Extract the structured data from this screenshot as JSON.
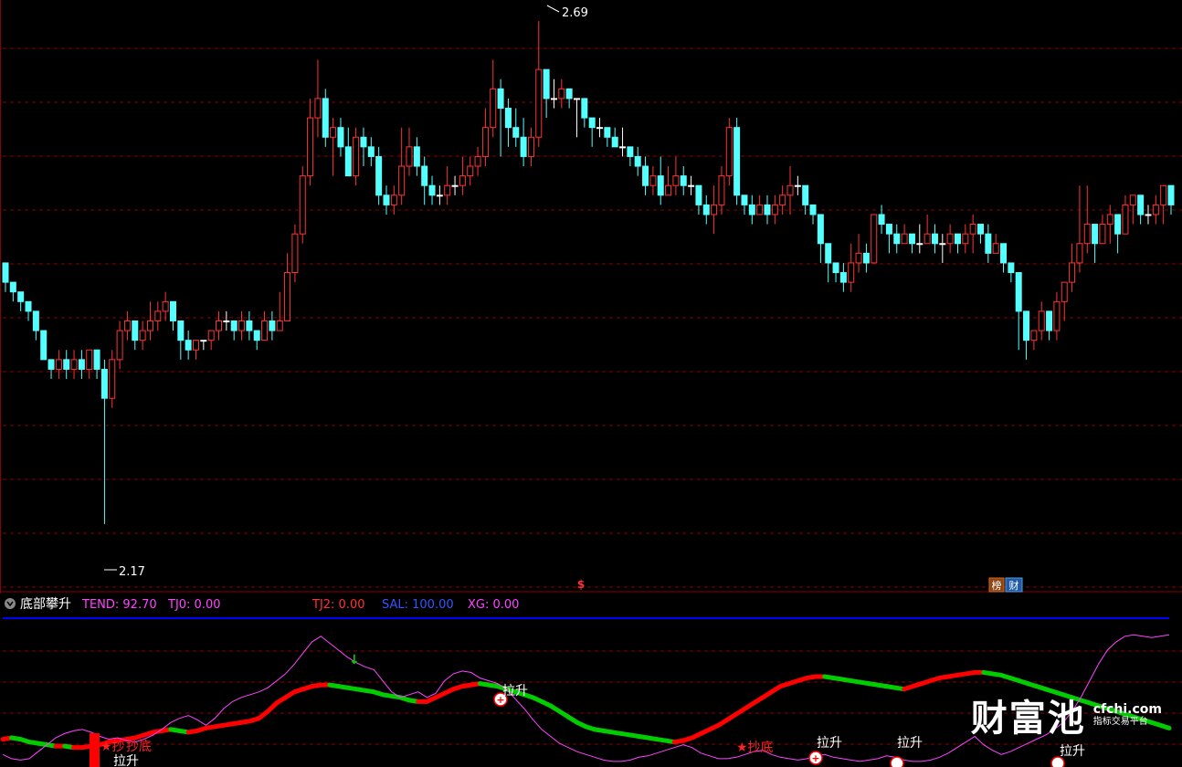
{
  "colors": {
    "up": "#ff3333",
    "down": "#54ffff",
    "flat": "#ffffff",
    "grid": "#8b0000",
    "separator": "#0000ff",
    "tend": "#ff44ff",
    "tj0": "#ff44ff",
    "tj2": "#ff3333",
    "sal": "#3355ff",
    "xg": "#ff44ff",
    "text": "#ffffff"
  },
  "price_panel": {
    "high_label": "2.69",
    "low_label": "2.17",
    "dollar_icon": "$",
    "badge1": "榜",
    "badge2": "财"
  },
  "indicator_panel": {
    "name": "底部攀升",
    "tend": "TEND: 92.70",
    "tj0": "TJ0: 0.00",
    "tj2": "TJ2: 0.00",
    "sal": "SAL: 100.00",
    "xg": "XG: 0.00"
  },
  "signals": {
    "rise": "拉升",
    "bottom": "抄底",
    "bottom_star": "★抄底",
    "bottom_double": "★抄",
    "arrow_down": "↓"
  },
  "watermark": {
    "main": "财富池",
    "en": "cfchi.com",
    "sub": "指标交易平台"
  },
  "chart_data": [
    {
      "type": "candlestick",
      "title": "",
      "y_visible_range": [
        2.1,
        2.71
      ],
      "max_label": 2.69,
      "min_label": 2.17,
      "grid": true,
      "candles": [
        [
          2.44,
          2.42,
          2.43,
          2.41
        ],
        [
          2.42,
          2.41,
          2.42,
          2.4
        ],
        [
          2.41,
          2.4,
          2.41,
          2.39
        ],
        [
          2.4,
          2.39,
          2.4,
          2.38
        ],
        [
          2.39,
          2.37,
          2.39,
          2.36
        ],
        [
          2.37,
          2.34,
          2.37,
          2.34
        ],
        [
          2.34,
          2.33,
          2.34,
          2.32
        ],
        [
          2.33,
          2.34,
          2.35,
          2.32
        ],
        [
          2.34,
          2.33,
          2.35,
          2.32
        ],
        [
          2.33,
          2.34,
          2.35,
          2.32
        ],
        [
          2.34,
          2.33,
          2.35,
          2.32
        ],
        [
          2.33,
          2.35,
          2.35,
          2.32
        ],
        [
          2.35,
          2.33,
          2.35,
          2.32
        ],
        [
          2.33,
          2.3,
          2.34,
          2.17
        ],
        [
          2.3,
          2.34,
          2.35,
          2.29
        ],
        [
          2.34,
          2.37,
          2.38,
          2.33
        ],
        [
          2.37,
          2.38,
          2.39,
          2.36
        ],
        [
          2.38,
          2.36,
          2.38,
          2.35
        ],
        [
          2.36,
          2.37,
          2.38,
          2.35
        ],
        [
          2.37,
          2.38,
          2.4,
          2.36
        ],
        [
          2.38,
          2.39,
          2.4,
          2.37
        ],
        [
          2.39,
          2.4,
          2.41,
          2.38
        ],
        [
          2.4,
          2.38,
          2.4,
          2.37
        ],
        [
          2.38,
          2.36,
          2.38,
          2.34
        ],
        [
          2.36,
          2.35,
          2.37,
          2.34
        ],
        [
          2.35,
          2.36,
          2.36,
          2.34
        ],
        [
          2.36,
          2.36,
          2.36,
          2.35
        ],
        [
          2.36,
          2.37,
          2.37,
          2.35
        ],
        [
          2.37,
          2.38,
          2.39,
          2.36
        ],
        [
          2.38,
          2.38,
          2.39,
          2.37
        ],
        [
          2.38,
          2.37,
          2.38,
          2.36
        ],
        [
          2.37,
          2.38,
          2.39,
          2.36
        ],
        [
          2.38,
          2.37,
          2.39,
          2.36
        ],
        [
          2.37,
          2.36,
          2.37,
          2.35
        ],
        [
          2.36,
          2.38,
          2.39,
          2.36
        ],
        [
          2.38,
          2.37,
          2.39,
          2.36
        ],
        [
          2.37,
          2.38,
          2.41,
          2.37
        ],
        [
          2.38,
          2.43,
          2.45,
          2.38
        ],
        [
          2.43,
          2.47,
          2.48,
          2.42
        ],
        [
          2.47,
          2.53,
          2.54,
          2.46
        ],
        [
          2.53,
          2.59,
          2.61,
          2.52
        ],
        [
          2.59,
          2.61,
          2.65,
          2.57
        ],
        [
          2.61,
          2.57,
          2.62,
          2.56
        ],
        [
          2.57,
          2.58,
          2.59,
          2.53
        ],
        [
          2.58,
          2.56,
          2.59,
          2.55
        ],
        [
          2.56,
          2.53,
          2.58,
          2.53
        ],
        [
          2.53,
          2.57,
          2.58,
          2.52
        ],
        [
          2.57,
          2.56,
          2.58,
          2.54
        ],
        [
          2.56,
          2.55,
          2.57,
          2.54
        ],
        [
          2.55,
          2.51,
          2.56,
          2.5
        ],
        [
          2.51,
          2.5,
          2.52,
          2.49
        ],
        [
          2.5,
          2.51,
          2.52,
          2.49
        ],
        [
          2.51,
          2.54,
          2.58,
          2.5
        ],
        [
          2.54,
          2.56,
          2.58,
          2.53
        ],
        [
          2.56,
          2.54,
          2.57,
          2.53
        ],
        [
          2.54,
          2.52,
          2.55,
          2.5
        ],
        [
          2.52,
          2.51,
          2.53,
          2.5
        ],
        [
          2.51,
          2.51,
          2.52,
          2.5
        ],
        [
          2.51,
          2.52,
          2.54,
          2.5
        ],
        [
          2.52,
          2.52,
          2.53,
          2.51
        ],
        [
          2.52,
          2.53,
          2.55,
          2.51
        ],
        [
          2.53,
          2.54,
          2.55,
          2.52
        ],
        [
          2.54,
          2.55,
          2.56,
          2.53
        ],
        [
          2.55,
          2.58,
          2.6,
          2.54
        ],
        [
          2.58,
          2.62,
          2.65,
          2.57
        ],
        [
          2.62,
          2.6,
          2.63,
          2.55
        ],
        [
          2.6,
          2.58,
          2.61,
          2.56
        ],
        [
          2.58,
          2.57,
          2.6,
          2.56
        ],
        [
          2.57,
          2.55,
          2.59,
          2.54
        ],
        [
          2.55,
          2.57,
          2.58,
          2.54
        ],
        [
          2.57,
          2.64,
          2.69,
          2.56
        ],
        [
          2.64,
          2.61,
          2.64,
          2.59
        ],
        [
          2.61,
          2.61,
          2.63,
          2.6
        ],
        [
          2.61,
          2.62,
          2.63,
          2.6
        ],
        [
          2.62,
          2.61,
          2.62,
          2.6
        ],
        [
          2.61,
          2.61,
          2.61,
          2.57
        ],
        [
          2.61,
          2.59,
          2.61,
          2.58
        ],
        [
          2.59,
          2.58,
          2.59,
          2.56
        ],
        [
          2.58,
          2.58,
          2.59,
          2.57
        ],
        [
          2.58,
          2.57,
          2.58,
          2.56
        ],
        [
          2.57,
          2.56,
          2.58,
          2.56
        ],
        [
          2.56,
          2.56,
          2.58,
          2.55
        ],
        [
          2.56,
          2.55,
          2.56,
          2.54
        ],
        [
          2.55,
          2.54,
          2.56,
          2.53
        ],
        [
          2.54,
          2.52,
          2.55,
          2.51
        ],
        [
          2.52,
          2.53,
          2.54,
          2.51
        ],
        [
          2.53,
          2.51,
          2.55,
          2.5
        ],
        [
          2.51,
          2.52,
          2.54,
          2.51
        ],
        [
          2.52,
          2.53,
          2.55,
          2.51
        ],
        [
          2.53,
          2.52,
          2.54,
          2.51
        ],
        [
          2.52,
          2.52,
          2.53,
          2.51
        ],
        [
          2.52,
          2.5,
          2.52,
          2.49
        ],
        [
          2.5,
          2.49,
          2.51,
          2.48
        ],
        [
          2.49,
          2.5,
          2.52,
          2.47
        ],
        [
          2.5,
          2.53,
          2.54,
          2.49
        ],
        [
          2.53,
          2.58,
          2.59,
          2.52
        ],
        [
          2.58,
          2.51,
          2.59,
          2.5
        ],
        [
          2.51,
          2.5,
          2.51,
          2.49
        ],
        [
          2.5,
          2.49,
          2.51,
          2.48
        ],
        [
          2.49,
          2.5,
          2.51,
          2.49
        ],
        [
          2.5,
          2.49,
          2.51,
          2.48
        ],
        [
          2.49,
          2.5,
          2.51,
          2.48
        ],
        [
          2.5,
          2.51,
          2.52,
          2.49
        ],
        [
          2.51,
          2.52,
          2.54,
          2.49
        ],
        [
          2.52,
          2.52,
          2.53,
          2.51
        ],
        [
          2.52,
          2.5,
          2.52,
          2.49
        ],
        [
          2.5,
          2.49,
          2.5,
          2.48
        ],
        [
          2.49,
          2.46,
          2.49,
          2.44
        ],
        [
          2.46,
          2.44,
          2.46,
          2.42
        ],
        [
          2.44,
          2.43,
          2.44,
          2.42
        ],
        [
          2.43,
          2.42,
          2.44,
          2.41
        ],
        [
          2.42,
          2.44,
          2.46,
          2.41
        ],
        [
          2.44,
          2.45,
          2.47,
          2.43
        ],
        [
          2.45,
          2.44,
          2.46,
          2.43
        ],
        [
          2.44,
          2.49,
          2.49,
          2.44
        ],
        [
          2.49,
          2.48,
          2.5,
          2.47
        ],
        [
          2.48,
          2.47,
          2.48,
          2.45
        ],
        [
          2.47,
          2.46,
          2.48,
          2.45
        ],
        [
          2.46,
          2.47,
          2.48,
          2.46
        ],
        [
          2.47,
          2.46,
          2.47,
          2.45
        ],
        [
          2.46,
          2.46,
          2.48,
          2.45
        ],
        [
          2.46,
          2.47,
          2.49,
          2.46
        ],
        [
          2.47,
          2.46,
          2.48,
          2.45
        ],
        [
          2.46,
          2.46,
          2.47,
          2.44
        ],
        [
          2.46,
          2.47,
          2.48,
          2.45
        ],
        [
          2.47,
          2.46,
          2.47,
          2.45
        ],
        [
          2.46,
          2.47,
          2.48,
          2.45
        ],
        [
          2.47,
          2.48,
          2.49,
          2.45
        ],
        [
          2.48,
          2.47,
          2.48,
          2.46
        ],
        [
          2.47,
          2.45,
          2.48,
          2.44
        ],
        [
          2.45,
          2.46,
          2.47,
          2.45
        ],
        [
          2.46,
          2.44,
          2.46,
          2.43
        ],
        [
          2.44,
          2.43,
          2.44,
          2.42
        ],
        [
          2.43,
          2.39,
          2.43,
          2.35
        ],
        [
          2.39,
          2.36,
          2.39,
          2.34
        ],
        [
          2.36,
          2.37,
          2.37,
          2.35
        ],
        [
          2.37,
          2.39,
          2.4,
          2.36
        ],
        [
          2.39,
          2.37,
          2.39,
          2.36
        ],
        [
          2.37,
          2.4,
          2.41,
          2.36
        ],
        [
          2.4,
          2.42,
          2.42,
          2.38
        ],
        [
          2.42,
          2.44,
          2.46,
          2.41
        ],
        [
          2.44,
          2.46,
          2.52,
          2.43
        ],
        [
          2.46,
          2.48,
          2.52,
          2.45
        ],
        [
          2.48,
          2.46,
          2.48,
          2.44
        ],
        [
          2.46,
          2.48,
          2.49,
          2.46
        ],
        [
          2.48,
          2.49,
          2.5,
          2.46
        ],
        [
          2.49,
          2.47,
          2.49,
          2.45
        ],
        [
          2.47,
          2.5,
          2.51,
          2.47
        ],
        [
          2.5,
          2.51,
          2.51,
          2.48
        ],
        [
          2.51,
          2.49,
          2.51,
          2.48
        ],
        [
          2.49,
          2.49,
          2.5,
          2.48
        ],
        [
          2.49,
          2.5,
          2.51,
          2.48
        ],
        [
          2.5,
          2.52,
          2.52,
          2.48
        ],
        [
          2.52,
          2.5,
          2.52,
          2.49
        ]
      ]
    },
    {
      "type": "line",
      "title": "",
      "y_visible_range": [
        -2,
        105
      ],
      "grid": true,
      "series": [
        {
          "name": "TEND",
          "color": "#ff44ff",
          "values": [
            7,
            4,
            3,
            4,
            9,
            14,
            19,
            22,
            24,
            25,
            23,
            20,
            18,
            19,
            17,
            16,
            18,
            21,
            25,
            30,
            33,
            35,
            32,
            28,
            33,
            40,
            45,
            48,
            50,
            52,
            55,
            60,
            65,
            72,
            80,
            88,
            92,
            87,
            82,
            77,
            73,
            70,
            68,
            60,
            52,
            48,
            50,
            52,
            48,
            51,
            60,
            65,
            67,
            66,
            62,
            60,
            58,
            54,
            47,
            40,
            32,
            25,
            20,
            15,
            12,
            9,
            7,
            5,
            3,
            2,
            2,
            3,
            5,
            6,
            8,
            10,
            12,
            14,
            12,
            8,
            6,
            4,
            4,
            5,
            7,
            9,
            10,
            7,
            5,
            4,
            3,
            4,
            6,
            7,
            5,
            4,
            3,
            2,
            3,
            4,
            6,
            5,
            3,
            2,
            2,
            3,
            5,
            8,
            12,
            16,
            20,
            14,
            10,
            7,
            9,
            12,
            15,
            18,
            21,
            25,
            30,
            38,
            48,
            60,
            72,
            82,
            88,
            92,
            93,
            92,
            91,
            92,
            93
          ]
        },
        {
          "name": "trend band",
          "values": [
            18,
            19,
            18,
            16,
            15,
            14,
            13,
            13,
            12,
            12,
            13,
            14,
            16,
            17,
            18,
            19,
            21,
            23,
            24,
            25,
            24,
            23,
            24,
            26,
            27,
            28,
            29,
            30,
            31,
            33,
            38,
            44,
            48,
            52,
            54,
            56,
            57,
            57,
            56,
            55,
            54,
            53,
            52,
            50,
            49,
            48,
            46,
            45,
            45,
            48,
            51,
            54,
            56,
            57,
            58,
            57,
            56,
            54,
            52,
            50,
            48,
            45,
            42,
            38,
            34,
            30,
            27,
            25,
            24,
            23,
            22,
            21,
            20,
            19,
            18,
            17,
            16,
            17,
            19,
            22,
            25,
            28,
            32,
            36,
            40,
            44,
            48,
            52,
            56,
            58,
            60,
            62,
            63,
            63,
            62,
            61,
            60,
            59,
            58,
            57,
            56,
            55,
            54,
            56,
            58,
            60,
            62,
            63,
            64,
            65,
            66,
            66,
            65,
            64,
            62,
            60,
            58,
            56,
            54,
            52,
            50,
            48,
            46,
            44,
            42,
            40,
            38,
            36,
            34,
            32,
            30,
            28,
            26
          ],
          "colors": [
            "#00cc00",
            "#ff0000"
          ]
        }
      ]
    }
  ]
}
